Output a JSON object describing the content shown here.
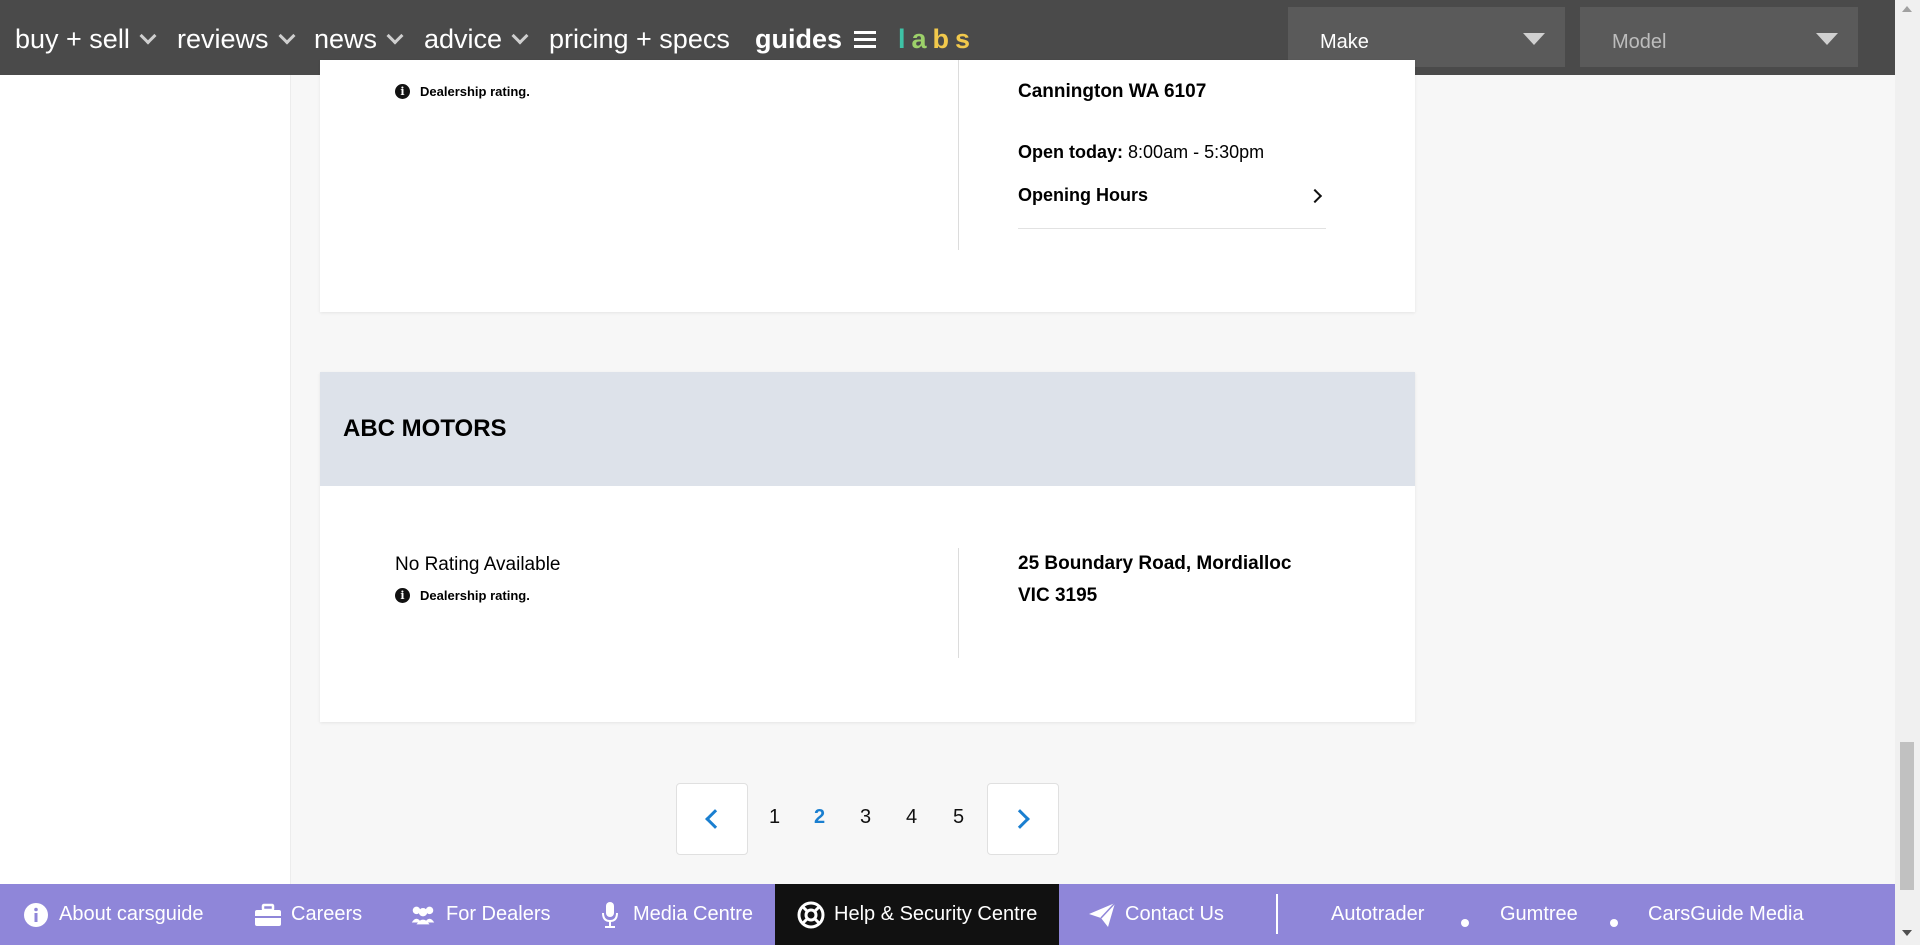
{
  "nav": {
    "items": [
      {
        "label": "buy + sell"
      },
      {
        "label": "reviews"
      },
      {
        "label": "news"
      },
      {
        "label": "advice"
      },
      {
        "label": "pricing + specs"
      },
      {
        "label": "guides"
      }
    ],
    "labs": [
      "l",
      "a",
      "b",
      "s"
    ],
    "make_select": {
      "value": "Make"
    },
    "model_select": {
      "value": "Model"
    }
  },
  "dealers": [
    {
      "rating_note": "Dealership rating.",
      "address_line2": "Cannington WA 6107",
      "open_today_label": "Open today:",
      "open_today_hours": "8:00am - 5:30pm",
      "opening_hours_label": "Opening Hours"
    },
    {
      "name": "ABC MOTORS",
      "rating": "No Rating Available",
      "rating_note": "Dealership rating.",
      "address_line1": "25 Boundary Road, Mordialloc",
      "address_line2": "VIC 3195"
    }
  ],
  "pagination": {
    "pages": [
      "1",
      "2",
      "3",
      "4",
      "5"
    ],
    "current": "2"
  },
  "footer": {
    "links": [
      {
        "label": "About carsguide",
        "icon": "info-circle-icon"
      },
      {
        "label": "Careers",
        "icon": "briefcase-icon"
      },
      {
        "label": "For Dealers",
        "icon": "users-icon"
      },
      {
        "label": "Media Centre",
        "icon": "microphone-icon"
      },
      {
        "label": "Help & Security Centre",
        "icon": "lifebuoy-icon"
      },
      {
        "label": "Contact Us",
        "icon": "paper-plane-icon"
      }
    ],
    "partners": [
      "Autotrader",
      "Gumtree",
      "CarsGuide Media"
    ]
  },
  "colors": {
    "nav_bg": "#4a4a4a",
    "footer_bg": "#8f86d9",
    "accent_blue": "#1a7fd0",
    "card_header_bg": "#dde2ea"
  }
}
